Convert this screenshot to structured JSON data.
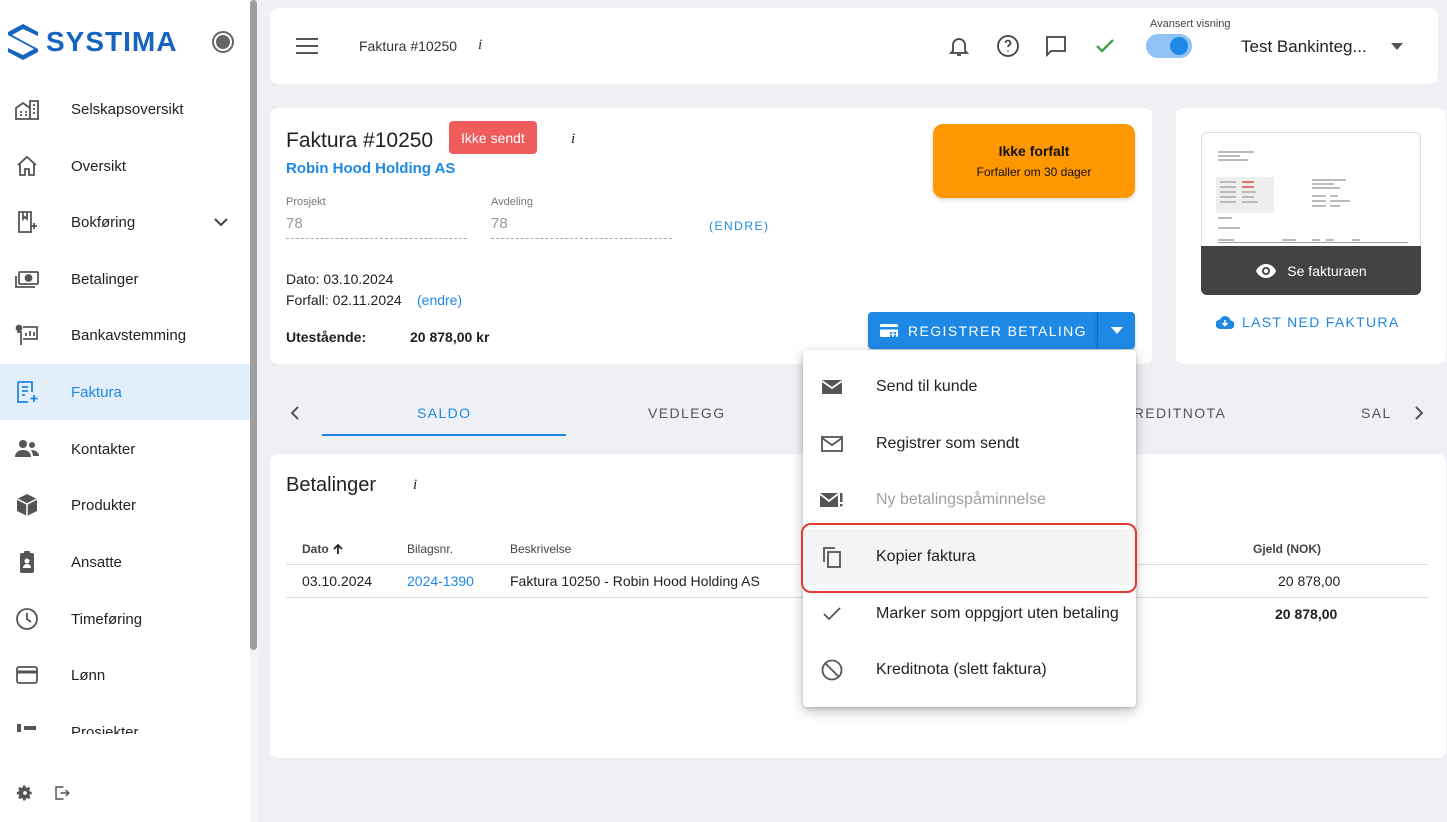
{
  "brand": {
    "name": "SYSTIMA",
    "logo_color": "#1565c0"
  },
  "sidebar": {
    "items": [
      {
        "label": "Selskapsoversikt",
        "icon": "building-icon"
      },
      {
        "label": "Oversikt",
        "icon": "home-icon"
      },
      {
        "label": "Bokføring",
        "icon": "ledger-icon"
      },
      {
        "label": "Betalinger",
        "icon": "payments-icon"
      },
      {
        "label": "Bankavstemming",
        "icon": "bank-reconciliation-icon"
      },
      {
        "label": "Faktura",
        "icon": "invoice-icon",
        "active": true
      },
      {
        "label": "Kontakter",
        "icon": "contacts-icon"
      },
      {
        "label": "Produkter",
        "icon": "product-box-icon"
      },
      {
        "label": "Ansatte",
        "icon": "employee-badge-icon"
      },
      {
        "label": "Timeføring",
        "icon": "clock-icon"
      },
      {
        "label": "Lønn",
        "icon": "credit-card-icon"
      },
      {
        "label": "Prosjekter",
        "icon": "projects-icon"
      }
    ]
  },
  "header": {
    "title": "Faktura #10250",
    "info": "i",
    "advanced_view_label": "Avansert visning",
    "company": "Test Bankinteg..."
  },
  "invoice": {
    "title": "Faktura #10250",
    "badge": "Ikke sendt",
    "info": "i",
    "customer": "Robin Hood Holding AS",
    "project_label": "Prosjekt",
    "project_value": "78",
    "department_label": "Avdeling",
    "department_value": "78",
    "edit_caps": "(ENDRE)",
    "date": "Dato: 03.10.2024",
    "due": "Forfall: 02.11.2024",
    "due_edit": "(endre)",
    "outstanding_label": "Utestående:",
    "outstanding_value": "20 878,00 kr",
    "status_title": "Ikke forfalt",
    "status_sub": "Forfaller om 30 dager",
    "register_payment": "REGISTRER BETALING"
  },
  "preview": {
    "view_label": "Se fakturaen",
    "download_label": "LAST NED FAKTURA"
  },
  "tabs": [
    "SALDO",
    "VEDLEGG",
    "KREDITNOTA",
    "SAL"
  ],
  "payments": {
    "title": "Betalinger",
    "info": "i",
    "columns": {
      "date": "Dato",
      "ref": "Bilagsnr.",
      "description": "Beskrivelse",
      "debt": "Gjeld (NOK)"
    },
    "rows": [
      {
        "date": "03.10.2024",
        "ref": "2024-1390",
        "description": "Faktura 10250 - Robin Hood Holding AS",
        "debt": "20 878,00"
      }
    ],
    "total": "20 878,00"
  },
  "menu": {
    "items": [
      {
        "label": "Send til kunde",
        "icon": "mail-filled-icon"
      },
      {
        "label": "Registrer som sendt",
        "icon": "mail-outline-icon"
      },
      {
        "label": "Ny betalingspåminnelse",
        "icon": "mail-alert-icon",
        "disabled": true
      },
      {
        "label": "Kopier faktura",
        "icon": "copy-icon",
        "highlighted": true
      },
      {
        "label": "Marker som oppgjort uten betaling",
        "icon": "check-icon"
      },
      {
        "label": "Kreditnota (slett faktura)",
        "icon": "block-icon"
      }
    ]
  },
  "colors": {
    "accent": "#1e88e5",
    "warning": "#ff9800",
    "danger": "#f05b5b",
    "success": "#43a047"
  }
}
